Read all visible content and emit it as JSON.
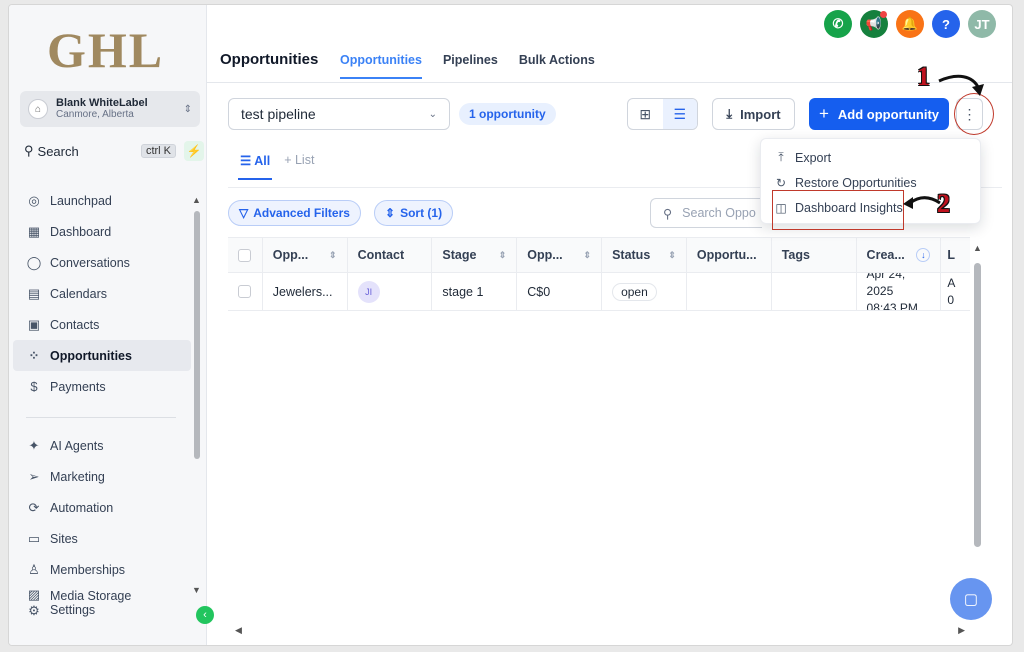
{
  "brand": {
    "logo_text": "GHL"
  },
  "account": {
    "name": "Blank WhiteLabel",
    "location": "Canmore, Alberta"
  },
  "sidebar_search": {
    "label": "Search",
    "shortcut": "ctrl K"
  },
  "nav_primary": [
    {
      "label": "Launchpad",
      "icon": "rocket-icon"
    },
    {
      "label": "Dashboard",
      "icon": "dashboard-icon"
    },
    {
      "label": "Conversations",
      "icon": "chat-icon"
    },
    {
      "label": "Calendars",
      "icon": "calendar-icon"
    },
    {
      "label": "Contacts",
      "icon": "contacts-icon"
    },
    {
      "label": "Opportunities",
      "icon": "opportunities-icon",
      "active": true
    },
    {
      "label": "Payments",
      "icon": "payments-icon"
    }
  ],
  "nav_secondary": [
    {
      "label": "AI Agents",
      "icon": "sparkle-icon"
    },
    {
      "label": "Marketing",
      "icon": "send-icon"
    },
    {
      "label": "Automation",
      "icon": "automation-icon"
    },
    {
      "label": "Sites",
      "icon": "sites-icon"
    },
    {
      "label": "Memberships",
      "icon": "memberships-icon"
    },
    {
      "label": "Media Storage",
      "icon": "media-icon"
    },
    {
      "label": "Settings",
      "icon": "gear-icon"
    }
  ],
  "header": {
    "title": "Opportunities",
    "tabs": [
      "Opportunities",
      "Pipelines",
      "Bulk Actions"
    ],
    "active_tab": "Opportunities",
    "avatar_initials": "JT",
    "help_label": "?"
  },
  "colors": {
    "primary": "#155eef",
    "phone": "#16a34a",
    "megaphone": "#15803d",
    "bell": "#f97316",
    "help": "#2563eb",
    "avatar": "#8fb9a8",
    "annotation": "#c0121e"
  },
  "toolbar": {
    "pipeline_value": "test pipeline",
    "opportunity_count": "1 opportunity",
    "import_label": "Import",
    "add_label": "Add opportunity",
    "more_label": "⋮"
  },
  "views": {
    "all_label": "All",
    "list_label": "List"
  },
  "filters": {
    "advanced_label": "Advanced Filters",
    "sort_label": "Sort (1)",
    "search_placeholder": "Search Oppo"
  },
  "table": {
    "columns": [
      "Opp...",
      "Contact",
      "Stage",
      "Opp...",
      "Status",
      "Opportu...",
      "Tags",
      "Crea...",
      "L"
    ],
    "rows": [
      {
        "name": "Jewelers...",
        "contact_initials": "JI",
        "stage": "stage 1",
        "value": "C$0",
        "status": "open",
        "source": "",
        "tags": "",
        "created_date": "Apr 24, 2025",
        "created_time": "08:43 PM",
        "last_partial_1": "A",
        "last_partial_2": "0"
      }
    ]
  },
  "menu": {
    "items": [
      {
        "label": "Export",
        "icon": "export-icon"
      },
      {
        "label": "Restore Opportunities",
        "icon": "restore-icon"
      },
      {
        "label": "Dashboard Insights",
        "icon": "dashboard-insights-icon"
      }
    ]
  },
  "annotations": {
    "step1": "1",
    "step2": "2"
  }
}
